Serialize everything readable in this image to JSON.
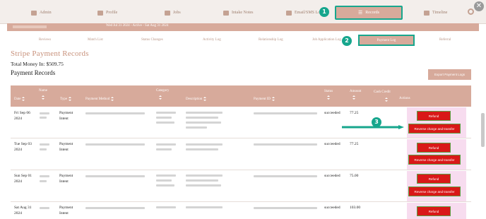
{
  "nav": {
    "items": [
      {
        "label": "Admin",
        "icon": "person-icon"
      },
      {
        "label": "Profile",
        "icon": "profile-icon"
      },
      {
        "label": "Jobs",
        "icon": "briefcase-icon"
      },
      {
        "label": "Intake Notes",
        "icon": "notes-icon"
      },
      {
        "label": "Email/SMS Log",
        "icon": "email-icon"
      },
      {
        "label": "Records",
        "icon": "list-icon"
      },
      {
        "label": "Timeline",
        "icon": "calendar-icon"
      }
    ],
    "active": "Records"
  },
  "badges": [
    "1",
    "2",
    "3"
  ],
  "infobar": {
    "text": "Wed Jul 31 2024 - Active - Sat Aug 31 2024"
  },
  "tabs": [
    "Reviews",
    "Match List",
    "Status Changes",
    "Activity Log",
    "Relationship Log",
    "Job Application Log",
    "Payment Log",
    "Referral"
  ],
  "active_tab": "Payment Log",
  "page": {
    "title": "Stripe Payment Records",
    "total": "Total Money In: $509.75",
    "subtitle": "Payment Records",
    "export": "Export Payment Logs"
  },
  "table": {
    "headers": [
      "Date",
      "Name",
      "Type",
      "Payment Method",
      "Category",
      "Description",
      "Payment ID",
      "Status",
      "Amount",
      "Cash Credit",
      "Actions"
    ],
    "rows": [
      {
        "date": "Fri Sep 06 2024",
        "type": "Payment Intent",
        "status": "succeeded",
        "amount": "77.25"
      },
      {
        "date": "Tue Sep 03 2024",
        "type": "Payment Intent",
        "status": "succeeded",
        "amount": "77.25"
      },
      {
        "date": "Sun Sep 01 2024",
        "type": "Payment Intent",
        "status": "succeeded",
        "amount": "75.00"
      },
      {
        "date": "Sat Aug 31 2024",
        "type": "Payment Intent",
        "status": "succeeded",
        "amount": "103.00"
      }
    ],
    "refund_label": "Refund",
    "reverse_label": "Reverse charge and transfer"
  },
  "colors": {
    "accent": "#d7aa9b",
    "highlight": "#17a68d",
    "danger": "#d91818",
    "title": "#c8927c"
  }
}
